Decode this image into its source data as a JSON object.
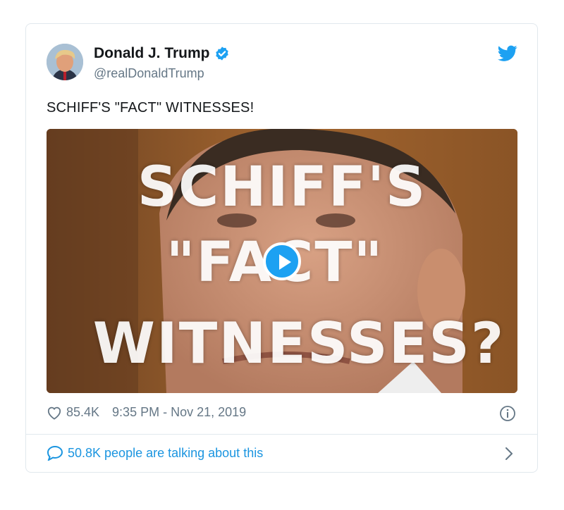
{
  "author": {
    "name": "Donald J. Trump",
    "handle": "@realDonaldTrump",
    "verified_icon": "verified-badge-icon"
  },
  "tweet": {
    "text": "SCHIFF'S \"FACT\" WITNESSES!"
  },
  "media": {
    "overlay_line1": "SCHIFF'S",
    "overlay_line2": "\"FACT\"",
    "overlay_line3": "WITNESSES?",
    "play_icon": "play-icon"
  },
  "stats": {
    "likes": "85.4K",
    "timestamp": "9:35 PM - Nov 21, 2019"
  },
  "footer": {
    "talking": "50.8K people are talking about this"
  },
  "colors": {
    "accent": "#1da1f2",
    "link": "#1b95e0",
    "muted": "#657786",
    "border": "#e1e8ed"
  }
}
